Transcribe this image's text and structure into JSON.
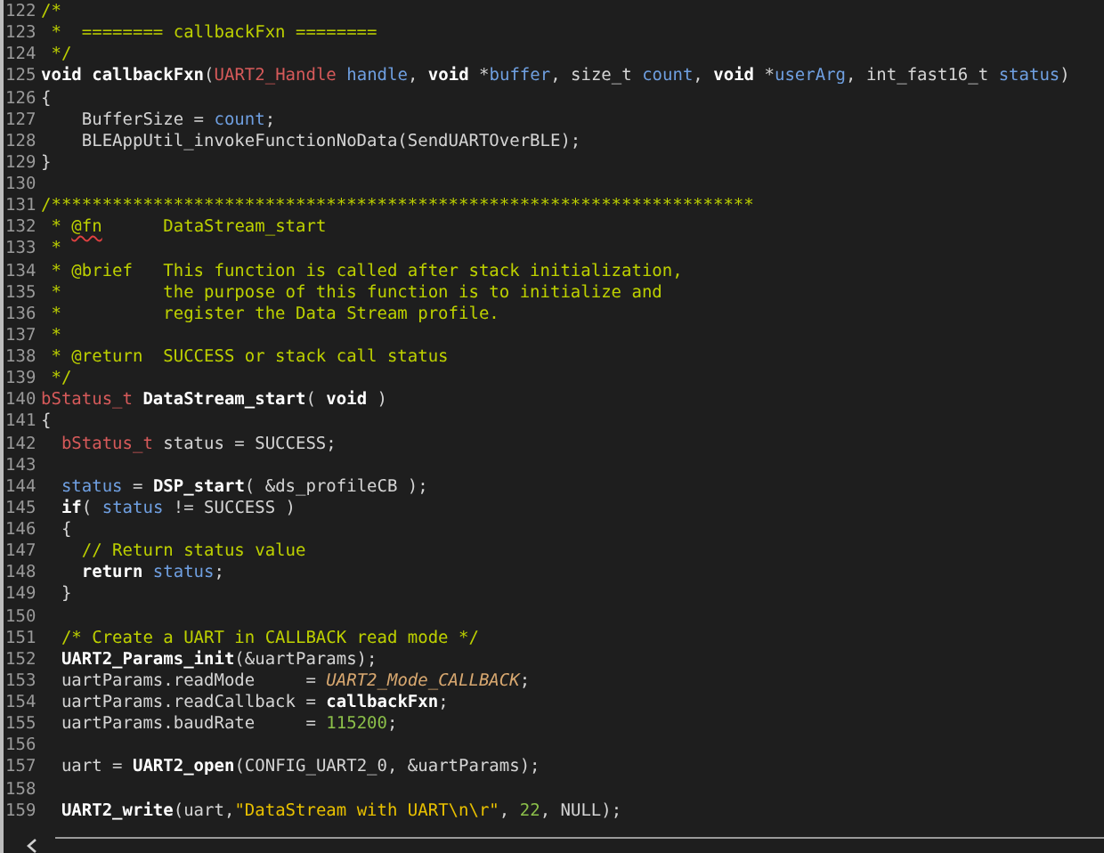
{
  "editor": {
    "lines": [
      {
        "number": "122",
        "tokens": [
          {
            "text": "/*",
            "kind": "comment"
          }
        ]
      },
      {
        "number": "123",
        "tokens": [
          {
            "text": " *  ======== callbackFxn ========",
            "kind": "comment"
          }
        ]
      },
      {
        "number": "124",
        "tokens": [
          {
            "text": " */",
            "kind": "comment"
          }
        ]
      },
      {
        "number": "125",
        "tokens": [
          {
            "text": "void",
            "kind": "bold"
          },
          {
            "text": " callbackFxn",
            "kind": "bold"
          },
          {
            "text": "(",
            "kind": "plain"
          },
          {
            "text": "UART2_Handle",
            "kind": "type"
          },
          {
            "text": " handle",
            "kind": "param"
          },
          {
            "text": ", ",
            "kind": "plain"
          },
          {
            "text": "void",
            "kind": "bold"
          },
          {
            "text": " *",
            "kind": "plain"
          },
          {
            "text": "buffer",
            "kind": "param"
          },
          {
            "text": ", size_t ",
            "kind": "plain"
          },
          {
            "text": "count",
            "kind": "param"
          },
          {
            "text": ", ",
            "kind": "plain"
          },
          {
            "text": "void",
            "kind": "bold"
          },
          {
            "text": " *",
            "kind": "plain"
          },
          {
            "text": "userArg",
            "kind": "param"
          },
          {
            "text": ", int_fast16_t ",
            "kind": "plain"
          },
          {
            "text": "status",
            "kind": "param"
          },
          {
            "text": ")",
            "kind": "plain"
          }
        ]
      },
      {
        "number": "126",
        "tokens": [
          {
            "text": "{",
            "kind": "plain"
          }
        ]
      },
      {
        "number": "127",
        "tokens": [
          {
            "text": "    BufferSize = ",
            "kind": "plain"
          },
          {
            "text": "count",
            "kind": "param"
          },
          {
            "text": ";",
            "kind": "plain"
          }
        ]
      },
      {
        "number": "128",
        "tokens": [
          {
            "text": "    BLEAppUtil_invokeFunctionNoData(SendUARTOverBLE);",
            "kind": "plain"
          }
        ]
      },
      {
        "number": "129",
        "tokens": [
          {
            "text": "}",
            "kind": "plain"
          }
        ]
      },
      {
        "number": "130"
      },
      {
        "number": "131",
        "tokens": [
          {
            "text": "/*********************************************************************",
            "kind": "comment"
          }
        ]
      },
      {
        "number": "132",
        "tokens": [
          {
            "text": " * ",
            "kind": "comment"
          },
          {
            "text": "@fn",
            "kind": "flagged_comment"
          },
          {
            "text": "      DataStream_start",
            "kind": "comment"
          }
        ]
      },
      {
        "number": "133",
        "tokens": [
          {
            "text": " *",
            "kind": "comment"
          }
        ]
      },
      {
        "number": "134",
        "tokens": [
          {
            "text": " * @brief   This function is called after stack initialization,",
            "kind": "comment"
          }
        ]
      },
      {
        "number": "135",
        "tokens": [
          {
            "text": " *          the purpose of this function is to initialize and",
            "kind": "comment"
          }
        ]
      },
      {
        "number": "136",
        "tokens": [
          {
            "text": " *          register the Data Stream profile.",
            "kind": "comment"
          }
        ]
      },
      {
        "number": "137",
        "tokens": [
          {
            "text": " *",
            "kind": "comment"
          }
        ]
      },
      {
        "number": "138",
        "tokens": [
          {
            "text": " * @return  SUCCESS or stack call status",
            "kind": "comment"
          }
        ]
      },
      {
        "number": "139",
        "tokens": [
          {
            "text": " */",
            "kind": "comment"
          }
        ]
      },
      {
        "number": "140",
        "tokens": [
          {
            "text": "bStatus_t",
            "kind": "type"
          },
          {
            "text": " DataStream_start",
            "kind": "bold"
          },
          {
            "text": "( ",
            "kind": "plain"
          },
          {
            "text": "void",
            "kind": "bold"
          },
          {
            "text": " )",
            "kind": "plain"
          }
        ]
      },
      {
        "number": "141",
        "tokens": [
          {
            "text": "{",
            "kind": "plain"
          }
        ]
      },
      {
        "number": "142",
        "tokens": [
          {
            "text": "  bStatus_t",
            "kind": "type"
          },
          {
            "text": " status = SUCCESS;",
            "kind": "plain"
          }
        ]
      },
      {
        "number": "143"
      },
      {
        "number": "144",
        "tokens": [
          {
            "text": "  status",
            "kind": "param"
          },
          {
            "text": " = ",
            "kind": "plain"
          },
          {
            "text": "DSP_start",
            "kind": "bold"
          },
          {
            "text": "( &ds_profileCB );",
            "kind": "plain"
          }
        ]
      },
      {
        "number": "145",
        "tokens": [
          {
            "text": "  if",
            "kind": "bold"
          },
          {
            "text": "( ",
            "kind": "plain"
          },
          {
            "text": "status",
            "kind": "param"
          },
          {
            "text": " != SUCCESS )",
            "kind": "plain"
          }
        ]
      },
      {
        "number": "146",
        "tokens": [
          {
            "text": "  {",
            "kind": "plain"
          }
        ]
      },
      {
        "number": "147",
        "tokens": [
          {
            "text": "    // Return status value",
            "kind": "comment"
          }
        ]
      },
      {
        "number": "148",
        "tokens": [
          {
            "text": "    return",
            "kind": "bold"
          },
          {
            "text": " status",
            "kind": "param"
          },
          {
            "text": ";",
            "kind": "plain"
          }
        ]
      },
      {
        "number": "149",
        "tokens": [
          {
            "text": "  }",
            "kind": "plain"
          }
        ]
      },
      {
        "number": "150"
      },
      {
        "number": "151",
        "tokens": [
          {
            "text": "  /* Create a UART in CALLBACK read mode */",
            "kind": "comment"
          }
        ]
      },
      {
        "number": "152",
        "tokens": [
          {
            "text": "  UART2_Params_init",
            "kind": "bold"
          },
          {
            "text": "(&uartParams);",
            "kind": "plain"
          }
        ]
      },
      {
        "number": "153",
        "tokens": [
          {
            "text": "  uartParams.readMode     = ",
            "kind": "plain"
          },
          {
            "text": "UART2_Mode_CALLBACK",
            "kind": "macro"
          },
          {
            "text": ";",
            "kind": "plain"
          }
        ]
      },
      {
        "number": "154",
        "tokens": [
          {
            "text": "  uartParams.readCallback = ",
            "kind": "plain"
          },
          {
            "text": "callbackFxn",
            "kind": "bold"
          },
          {
            "text": ";",
            "kind": "plain"
          }
        ]
      },
      {
        "number": "155",
        "tokens": [
          {
            "text": "  uartParams.baudRate     = ",
            "kind": "plain"
          },
          {
            "text": "115200",
            "kind": "number"
          },
          {
            "text": ";",
            "kind": "plain"
          }
        ]
      },
      {
        "number": "156"
      },
      {
        "number": "157",
        "tokens": [
          {
            "text": "  uart = ",
            "kind": "plain"
          },
          {
            "text": "UART2_open",
            "kind": "bold"
          },
          {
            "text": "(CONFIG_UART2_0, &uartParams);",
            "kind": "plain"
          }
        ]
      },
      {
        "number": "158"
      },
      {
        "number": "159",
        "tokens": [
          {
            "text": "  UART2_write",
            "kind": "bold"
          },
          {
            "text": "(uart,",
            "kind": "plain"
          },
          {
            "text": "\"DataStream with UART\\n\\r\"",
            "kind": "string"
          },
          {
            "text": ", ",
            "kind": "plain"
          },
          {
            "text": "22",
            "kind": "number"
          },
          {
            "text": ", NULL);",
            "kind": "plain"
          }
        ]
      }
    ]
  }
}
